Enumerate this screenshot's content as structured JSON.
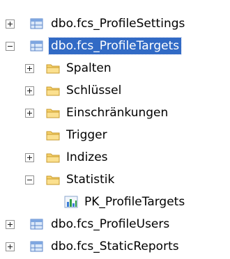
{
  "tree": {
    "rows": [
      {
        "label": "dbo.fcs_ProfileSettings",
        "icon": "table-icon",
        "toggle": "plus"
      },
      {
        "label": "dbo.fcs_ProfileTargets",
        "icon": "table-icon",
        "toggle": "minus",
        "selected": true
      },
      {
        "label": "Spalten",
        "icon": "folder-icon",
        "toggle": "plus"
      },
      {
        "label": "Schlüssel",
        "icon": "folder-icon",
        "toggle": "plus"
      },
      {
        "label": "Einschränkungen",
        "icon": "folder-icon",
        "toggle": "plus"
      },
      {
        "label": "Trigger",
        "icon": "folder-icon",
        "toggle": "none"
      },
      {
        "label": "Indizes",
        "icon": "folder-icon",
        "toggle": "plus"
      },
      {
        "label": "Statistik",
        "icon": "folder-icon",
        "toggle": "minus"
      },
      {
        "label": "PK_ProfileTargets",
        "icon": "statistics-icon",
        "toggle": "none"
      },
      {
        "label": "dbo.fcs_ProfileUsers",
        "icon": "table-icon",
        "toggle": "plus"
      },
      {
        "label": "dbo.fcs_StaticReports",
        "icon": "table-icon",
        "toggle": "plus"
      }
    ]
  },
  "colors": {
    "selection": "#316ac5",
    "folder": "#f7d26b",
    "table": "#8fb3e8"
  }
}
